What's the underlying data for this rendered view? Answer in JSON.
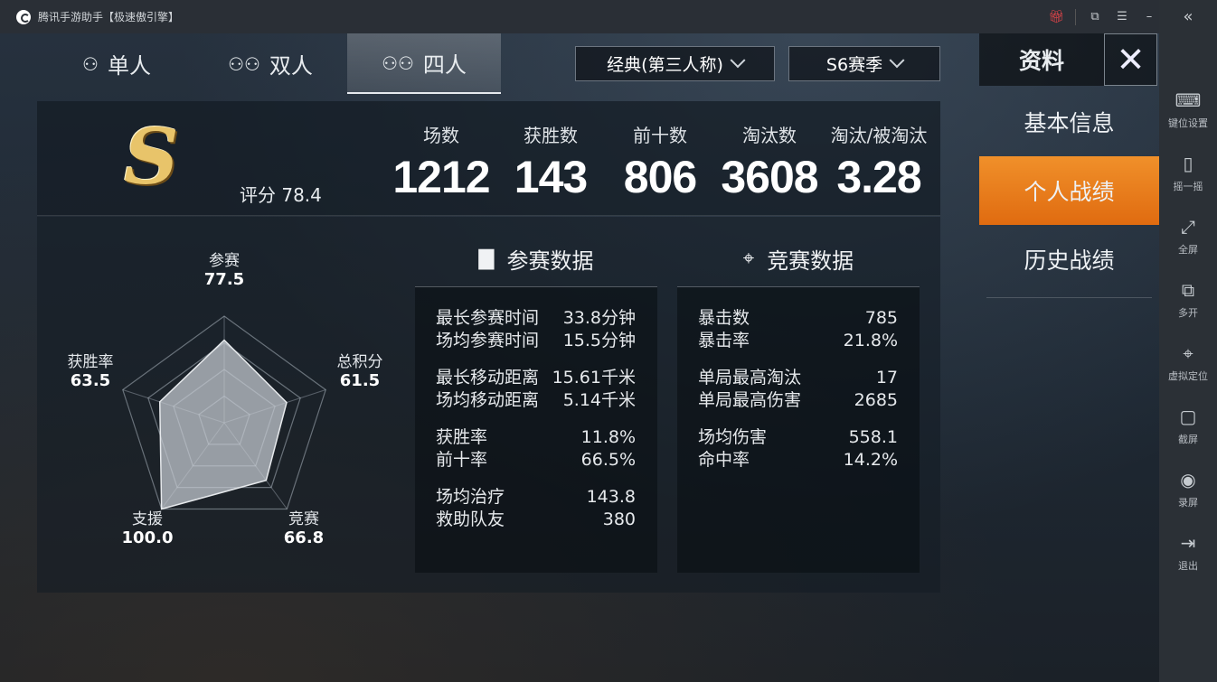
{
  "window": {
    "title": "腾讯手游助手【极速傲引擎】",
    "controls": [
      "gift-icon",
      "popout-icon",
      "menu-icon",
      "minimize-icon",
      "maximize-icon",
      "close-icon"
    ]
  },
  "tabs": [
    {
      "label": "单人",
      "icon": "single-player-icon",
      "active": false
    },
    {
      "label": "双人",
      "icon": "duo-icon",
      "active": false
    },
    {
      "label": "四人",
      "icon": "squad-icon",
      "active": true
    }
  ],
  "filters": {
    "mode": "经典(第三人称)",
    "season": "S6赛季"
  },
  "summary": {
    "rank": "S",
    "score_label": "评分",
    "score": "78.4",
    "stats": [
      {
        "label": "场数",
        "value": "1212"
      },
      {
        "label": "获胜数",
        "value": "143"
      },
      {
        "label": "前十数",
        "value": "806"
      },
      {
        "label": "淘汰数",
        "value": "3608"
      },
      {
        "label": "淘汰/被淘汰",
        "value": "3.28"
      }
    ]
  },
  "radar": {
    "axes": [
      {
        "label": "参赛",
        "value": 77.5,
        "display": "77.5"
      },
      {
        "label": "总积分",
        "value": 61.5,
        "display": "61.5"
      },
      {
        "label": "竞赛",
        "value": 66.8,
        "display": "66.8"
      },
      {
        "label": "支援",
        "value": 100.0,
        "display": "100.0"
      },
      {
        "label": "获胜率",
        "value": 63.5,
        "display": "63.5"
      }
    ],
    "max": 100
  },
  "participation": {
    "title": "参赛数据",
    "icon": "bar-chart-icon",
    "groups": [
      [
        {
          "label": "最长参赛时间",
          "value": "33.8分钟"
        },
        {
          "label": "场均参赛时间",
          "value": "15.5分钟"
        }
      ],
      [
        {
          "label": "最长移动距离",
          "value": "15.61千米"
        },
        {
          "label": "场均移动距离",
          "value": "5.14千米"
        }
      ],
      [
        {
          "label": "获胜率",
          "value": "11.8%"
        },
        {
          "label": "前十率",
          "value": "66.5%"
        }
      ],
      [
        {
          "label": "场均治疗",
          "value": "143.8"
        },
        {
          "label": "救助队友",
          "value": "380"
        }
      ]
    ]
  },
  "combat": {
    "title": "竞赛数据",
    "icon": "crosshair-icon",
    "groups": [
      [
        {
          "label": "暴击数",
          "value": "785"
        },
        {
          "label": "暴击率",
          "value": "21.8%"
        }
      ],
      [
        {
          "label": "单局最高淘汰",
          "value": "17"
        },
        {
          "label": "单局最高伤害",
          "value": "2685"
        }
      ],
      [
        {
          "label": "场均伤害",
          "value": "558.1"
        },
        {
          "label": "命中率",
          "value": "14.2%"
        }
      ]
    ]
  },
  "right_menu": {
    "title": "资料",
    "items": [
      {
        "label": "基本信息",
        "active": false
      },
      {
        "label": "个人战绩",
        "active": true
      },
      {
        "label": "历史战绩",
        "active": false
      }
    ]
  },
  "sidebar": {
    "items": [
      {
        "label": "键位设置",
        "icon": "keyboard-icon"
      },
      {
        "label": "摇一摇",
        "icon": "shake-icon"
      },
      {
        "label": "全屏",
        "icon": "fullscreen-icon"
      },
      {
        "label": "多开",
        "icon": "multi-instance-icon"
      },
      {
        "label": "虚拟定位",
        "icon": "location-icon"
      },
      {
        "label": "截屏",
        "icon": "screenshot-icon"
      },
      {
        "label": "录屏",
        "icon": "record-icon"
      },
      {
        "label": "退出",
        "icon": "exit-icon"
      }
    ]
  },
  "colors": {
    "accent": "#e8781a",
    "gold": "#e8c46a",
    "panel": "#141c24"
  }
}
